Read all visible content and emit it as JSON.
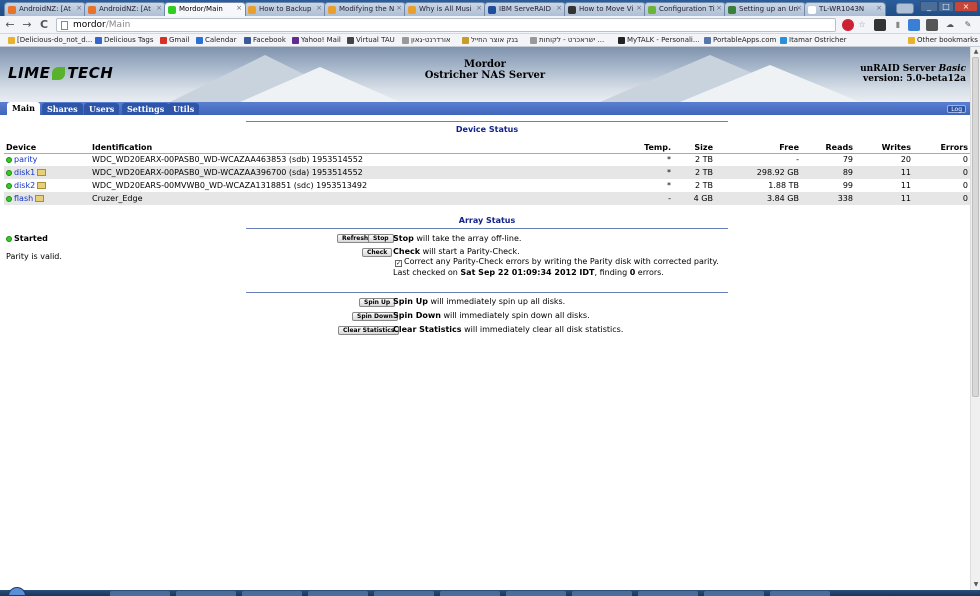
{
  "browser": {
    "tabs": [
      {
        "title": "AndroidNZ: [At",
        "color": "#e8732a"
      },
      {
        "title": "AndroidNZ: [At",
        "color": "#e8732a"
      },
      {
        "title": "Mordor/Main",
        "color": "#33cc22",
        "active": true
      },
      {
        "title": "How to Backup",
        "color": "#e8a02a"
      },
      {
        "title": "Modifying the N",
        "color": "#e8a02a"
      },
      {
        "title": "Why is All Musi",
        "color": "#e8a02a"
      },
      {
        "title": "IBM ServeRAID",
        "color": "#1f4f9a"
      },
      {
        "title": "How to Move Vi",
        "color": "#333333"
      },
      {
        "title": "Configuration Ti",
        "color": "#6cb33a"
      },
      {
        "title": "Setting up an Un",
        "color": "#3a7f3a"
      },
      {
        "title": "TL-WR1043N",
        "color": "#ffffff"
      }
    ],
    "url_host": "mordor",
    "url_path": "/Main",
    "bookmarks": [
      {
        "label": "[Delicious-do_not_d...",
        "color": "#e8b22a"
      },
      {
        "label": "Delicious Tags",
        "color": "#3366cc"
      },
      {
        "label": "Gmail",
        "color": "#d93025"
      },
      {
        "label": "Calendar",
        "color": "#2a6fd6"
      },
      {
        "label": "Facebook",
        "color": "#3b5998"
      },
      {
        "label": "Yahoo! Mail",
        "color": "#5f2d91"
      },
      {
        "label": "Virtual TAU",
        "color": "#444444"
      },
      {
        "label": "אורדרנט-גאון",
        "color": "#999999"
      },
      {
        "label": "בנק אוצר החייל",
        "color": "#c89b2a"
      },
      {
        "label": "ישראכרט - לקוחות ...",
        "color": "#999999"
      },
      {
        "label": "MyTALK - Personali...",
        "color": "#222222"
      },
      {
        "label": "PortableApps.com",
        "color": "#5577aa"
      },
      {
        "label": "Itamar Ostricher",
        "color": "#2a8fd6"
      }
    ],
    "other_bookmarks": "Other bookmarks"
  },
  "header": {
    "logo_left": "LIME",
    "logo_right": "TECH",
    "server_name": "Mordor",
    "server_desc": "Ostricher NAS Server",
    "version_line1_prefix": "unRAID Server ",
    "version_line1_edition": "Basic",
    "version_line2": "version: 5.0-beta12a"
  },
  "nav": {
    "tabs": [
      "Main",
      "Shares",
      "Users",
      "Settings",
      "Utils"
    ],
    "active": "Main",
    "log_label": "Log"
  },
  "device_status": {
    "title": "Device Status",
    "columns": [
      "Device",
      "Identification",
      "Temp.",
      "Size",
      "Free",
      "Reads",
      "Writes",
      "Errors"
    ],
    "rows": [
      {
        "device": "parity",
        "id": "WDC_WD20EARX-00PASB0_WD-WCAZAA463853 (sdb) 1953514552",
        "temp": "*",
        "size": "2 TB",
        "free": "-",
        "reads": "79",
        "writes": "20",
        "errors": "0",
        "icon": false
      },
      {
        "device": "disk1",
        "id": "WDC_WD20EARX-00PASB0_WD-WCAZAA396700 (sda) 1953514552",
        "temp": "*",
        "size": "2 TB",
        "free": "298.92 GB",
        "reads": "89",
        "writes": "11",
        "errors": "0",
        "icon": true
      },
      {
        "device": "disk2",
        "id": "WDC_WD20EARS-00MVWB0_WD-WCAZA1318851 (sdc) 1953513492",
        "temp": "*",
        "size": "2 TB",
        "free": "1.88 TB",
        "reads": "99",
        "writes": "11",
        "errors": "0",
        "icon": true
      },
      {
        "device": "flash",
        "id": "Cruzer_Edge",
        "temp": "-",
        "size": "4 GB",
        "free": "3.84 GB",
        "reads": "338",
        "writes": "11",
        "errors": "0",
        "icon": true
      }
    ]
  },
  "array_status": {
    "title": "Array Status",
    "state": "Started",
    "parity_msg": "Parity is valid.",
    "refresh_label": "Refresh",
    "stop_label": "Stop",
    "stop_bold": "Stop",
    "stop_text": " will take the array off-line.",
    "check_label": "Check",
    "check_bold": "Check",
    "check_text": " will start a Parity-Check.",
    "correct_text": "Correct any Parity-Check errors by writing the Parity disk with corrected parity.",
    "correct_checked": true,
    "last_checked_prefix": "Last checked on ",
    "last_checked_date": "Sat Sep 22 01:09:34 2012 IDT",
    "last_checked_mid": ", finding ",
    "last_checked_errors": "0",
    "last_checked_suffix": " errors.",
    "spinup_label": "Spin Up",
    "spinup_bold": "Spin Up",
    "spinup_text": " will immediately spin up all disks.",
    "spindown_label": "Spin Down",
    "spindown_bold": "Spin Down",
    "spindown_text": " will immediately spin down all disks.",
    "clear_label": "Clear Statistics",
    "clear_bold": "Clear Statistics",
    "clear_text": " will immediately clear all disk statistics."
  }
}
